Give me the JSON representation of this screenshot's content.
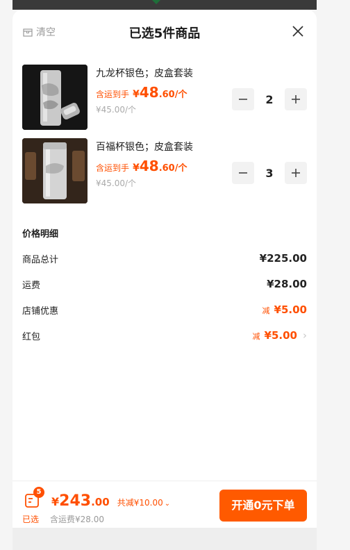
{
  "sheet": {
    "clear_label": "清空",
    "title": "已选5件商品"
  },
  "items": [
    {
      "name": "九龙杯银色；皮盒套装",
      "price_label": "含运到手",
      "currency": "¥",
      "price_int": "48",
      "price_dec": ".60/个",
      "original_price": "¥45.00/个",
      "quantity": "2"
    },
    {
      "name": "百福杯银色；皮盒套装",
      "price_label": "含运到手",
      "currency": "¥",
      "price_int": "48",
      "price_dec": ".60/个",
      "original_price": "¥45.00/个",
      "quantity": "3"
    }
  ],
  "price_detail": {
    "title": "价格明细",
    "rows": [
      {
        "label": "商品总计",
        "value": "¥225.00"
      },
      {
        "label": "运费",
        "value": "¥28.00"
      },
      {
        "label": "店铺优惠",
        "prefix": "减",
        "value": "¥5.00"
      },
      {
        "label": "红包",
        "prefix": "减",
        "value": "¥5.00"
      }
    ]
  },
  "bottom": {
    "badge_count": "5",
    "selected_label": "已选",
    "currency": "¥",
    "total_int": "243",
    "total_dec": ".00",
    "saving": "共减¥10.00",
    "shipping_note": "含运费¥28.00",
    "checkout_label": "开通0元下单"
  },
  "colors": {
    "accent": "#ff5a00",
    "price": "#ff4f00"
  },
  "icons": [
    "box-icon",
    "close-icon",
    "minus-icon",
    "plus-icon",
    "chevron-right-icon",
    "chevron-down-icon",
    "cart-icon"
  ]
}
